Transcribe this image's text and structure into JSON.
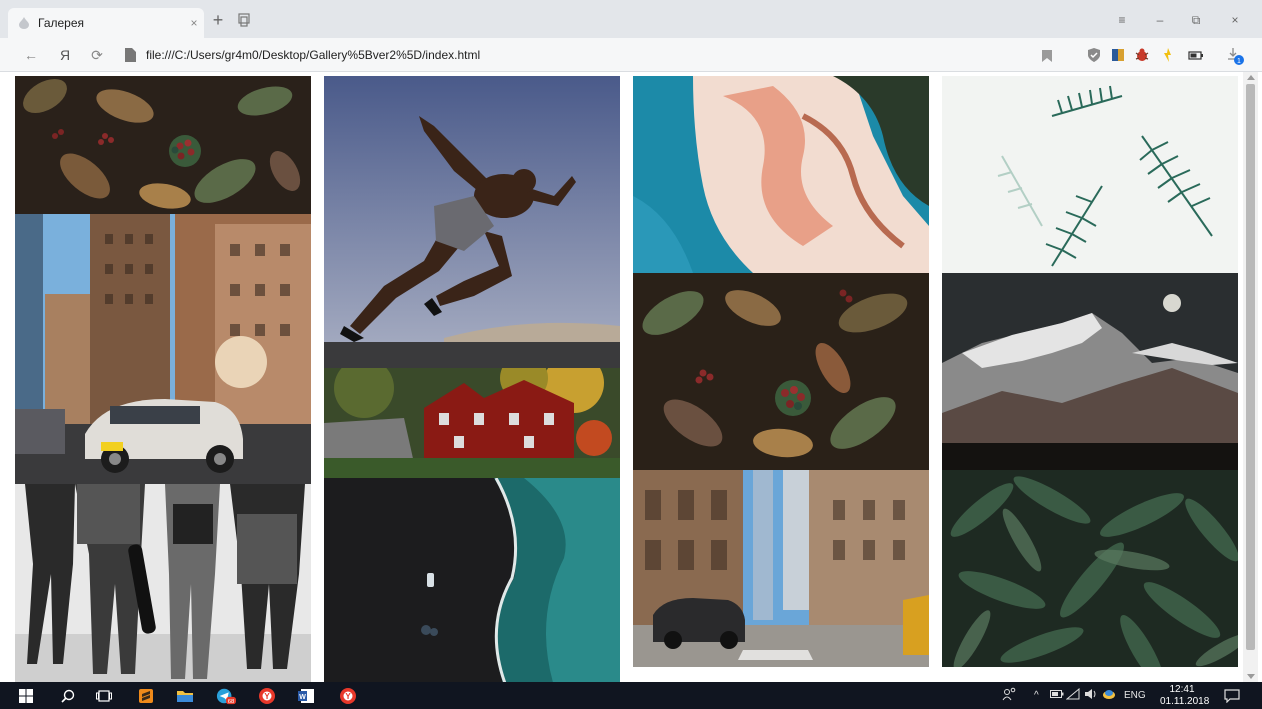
{
  "browser": {
    "tab_title": "Галерея",
    "tab_close": "×",
    "new_tab": "+",
    "url": "file:///C:/Users/gr4m0/Desktop/Gallery%5Bver2%5D/index.html",
    "back": "←",
    "home": "Я",
    "reload": "⟳",
    "menu": "≡",
    "minimize": "–",
    "restore": "⧉",
    "close": "×",
    "download_count": "1"
  },
  "gallery": {
    "columns": [
      {
        "tiles": [
          {
            "subject": "autumn leaves with berries",
            "palette": [
              "#3a2a1e",
              "#7a5a3a",
              "#5a6a48",
              "#8b2a2a"
            ]
          },
          {
            "subject": "city street with skyscrapers and white SUV",
            "palette": [
              "#6aa6d8",
              "#8a6a50",
              "#d8d6d2",
              "#3a3a3a"
            ]
          },
          {
            "subject": "black and white people walking with skateboard",
            "palette": [
              "#f0f0f0",
              "#1c1c1c",
              "#888888",
              "#444444"
            ]
          }
        ]
      },
      {
        "tiles": [
          {
            "subject": "sprinting athlete against blue sky",
            "palette": [
              "#4a5a8a",
              "#8a9ac0",
              "#3a2418",
              "#c2b8a8"
            ]
          },
          {
            "subject": "stone house covered in red ivy",
            "palette": [
              "#3a4a2a",
              "#9a2018",
              "#c8a030",
              "#6a6a6a"
            ]
          },
          {
            "subject": "aerial beach with car on dark sand",
            "palette": [
              "#1c1c1e",
              "#1c6a6a",
              "#2a8a8a",
              "#e0e8e8"
            ]
          }
        ]
      },
      {
        "tiles": [
          {
            "subject": "aerial river delta in pink and teal",
            "palette": [
              "#1c8aa8",
              "#e8a088",
              "#f2dcd0",
              "#2a3a2a"
            ]
          },
          {
            "subject": "leaves with berries closeup",
            "palette": [
              "#3a2a1e",
              "#8a6a4a",
              "#5a6a48",
              "#8b2a2a"
            ]
          },
          {
            "subject": "city street with tall buildings and cars",
            "palette": [
              "#6aa6d8",
              "#8a6a50",
              "#c8b8a0",
              "#2a2a2a"
            ]
          }
        ]
      },
      {
        "tiles": [
          {
            "subject": "fern leaves on white",
            "palette": [
              "#f2f4f2",
              "#2a6a5a",
              "#8ab8a8"
            ]
          },
          {
            "subject": "snowy mountains at night with moon",
            "palette": [
              "#2a2e30",
              "#c8c8c8",
              "#5a4a44",
              "#141210"
            ]
          },
          {
            "subject": "dark green leaves",
            "palette": [
              "#1e2a22",
              "#3a5a44",
              "#5a7a60"
            ]
          }
        ]
      }
    ]
  },
  "taskbar": {
    "tray_lang": "ENG",
    "time": "12:41",
    "date": "01.11.2018",
    "telegram_badge": "68"
  }
}
